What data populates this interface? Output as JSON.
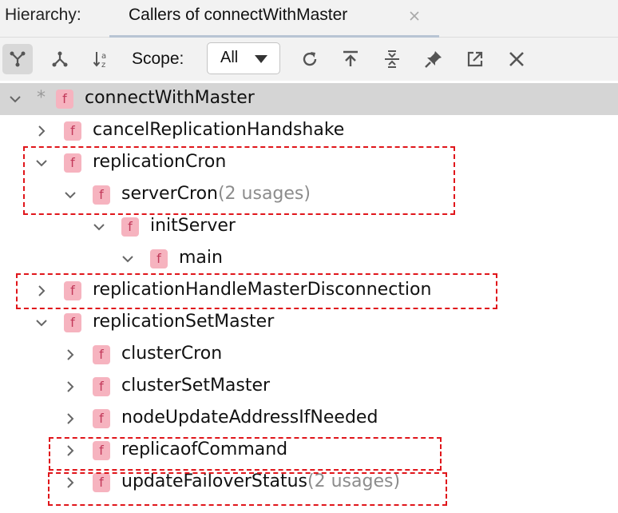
{
  "header": {
    "hierarchy_label": "Hierarchy:",
    "tab_title": "Callers of connectWithMaster"
  },
  "toolbar": {
    "buttons": [
      {
        "icon": "caller-hierarchy-icon",
        "active": true
      },
      {
        "icon": "callee-hierarchy-icon",
        "active": false
      },
      {
        "icon": "sort-alphabetically-icon",
        "active": false
      },
      {
        "icon": "refresh-icon",
        "active": false
      },
      {
        "icon": "export-icon",
        "active": false
      },
      {
        "icon": "expand-all-icon",
        "active": false
      },
      {
        "icon": "pin-icon",
        "active": false
      },
      {
        "icon": "open-in-window-icon",
        "active": false
      },
      {
        "icon": "close-icon",
        "active": false
      }
    ],
    "scope_label": "Scope:",
    "scope_value": "All"
  },
  "tree": [
    {
      "name": "connectWithMaster",
      "usage": "",
      "level": 0,
      "expanded": true,
      "root": true,
      "selected": true
    },
    {
      "name": "cancelReplicationHandshake",
      "usage": "",
      "level": 1,
      "expanded": false
    },
    {
      "name": "replicationCron",
      "usage": "",
      "level": 1,
      "expanded": true
    },
    {
      "name": "serverCron",
      "usage": "(2 usages)",
      "level": 2,
      "expanded": true
    },
    {
      "name": "initServer",
      "usage": "",
      "level": 3,
      "expanded": true
    },
    {
      "name": "main",
      "usage": "",
      "level": 4,
      "expanded": true
    },
    {
      "name": "replicationHandleMasterDisconnection",
      "usage": "",
      "level": 1,
      "expanded": false
    },
    {
      "name": "replicationSetMaster",
      "usage": "",
      "level": 1,
      "expanded": true
    },
    {
      "name": "clusterCron",
      "usage": "",
      "level": 2,
      "expanded": false
    },
    {
      "name": "clusterSetMaster",
      "usage": "",
      "level": 2,
      "expanded": false
    },
    {
      "name": "nodeUpdateAddressIfNeeded",
      "usage": "",
      "level": 2,
      "expanded": false
    },
    {
      "name": "replicaofCommand",
      "usage": "",
      "level": 2,
      "expanded": false
    },
    {
      "name": "updateFailoverStatus",
      "usage": "(2 usages)",
      "level": 2,
      "expanded": false
    }
  ],
  "icon_letter": "f",
  "colors": {
    "function_icon_bg": "#f6b3bf",
    "function_icon_fg": "#c2395a",
    "highlight_box": "#e0161b",
    "selected_row": "#d5d5d5",
    "usage_text": "#8c8c8c"
  }
}
